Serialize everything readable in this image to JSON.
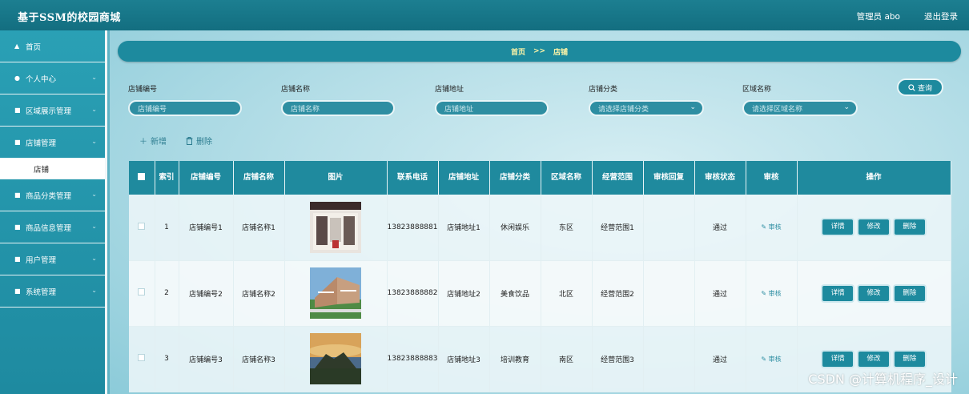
{
  "header": {
    "title": "基于SSM的校园商城",
    "role": "管理员 abo",
    "logout": "退出登录"
  },
  "sidebar": {
    "items": [
      {
        "label": "首页",
        "icon": "home-icon",
        "glyph": "▲",
        "chevron": false
      },
      {
        "label": "个人中心",
        "icon": "user-icon",
        "glyph": "●",
        "chevron": true
      },
      {
        "label": "区域展示管理",
        "icon": "comment-icon",
        "glyph": "■",
        "chevron": true
      },
      {
        "label": "店铺管理",
        "icon": "store-icon",
        "glyph": "■",
        "chevron": true
      },
      {
        "label": "商品分类管理",
        "icon": "grid-icon",
        "glyph": "■",
        "chevron": true
      },
      {
        "label": "商品信息管理",
        "icon": "grid-icon",
        "glyph": "■",
        "chevron": true
      },
      {
        "label": "用户管理",
        "icon": "users-icon",
        "glyph": "■",
        "chevron": true
      },
      {
        "label": "系统管理",
        "icon": "grid-icon",
        "glyph": "■",
        "chevron": true
      }
    ],
    "submenu_label": "店铺",
    "chevron_glyph": "⌄"
  },
  "breadcrumb": {
    "home": "首页",
    "separator": ">>",
    "current": "店铺"
  },
  "filters": [
    {
      "label": "店铺编号",
      "placeholder": "店铺编号"
    },
    {
      "label": "店铺名称",
      "placeholder": "店铺名称"
    },
    {
      "label": "店铺地址",
      "placeholder": "店铺地址"
    },
    {
      "label": "店铺分类",
      "placeholder": "请选择店铺分类"
    },
    {
      "label": "区域名称",
      "placeholder": "请选择区域名称"
    }
  ],
  "search_button": "查询",
  "actions": {
    "add": "新增",
    "delete": "删除"
  },
  "table": {
    "headers": [
      "索引",
      "店铺编号",
      "店铺名称",
      "图片",
      "联系电话",
      "店铺地址",
      "店铺分类",
      "区域名称",
      "经营范围",
      "审核回复",
      "审核状态",
      "审核",
      "操作"
    ],
    "rows": [
      {
        "index": "1",
        "code": "店铺编号1",
        "name": "店铺名称1",
        "phone": "13823888881",
        "address": "店铺地址1",
        "category": "休闲娱乐",
        "area": "东区",
        "scope": "经营范围1",
        "reply": "",
        "status": "通过",
        "audit": "审核"
      },
      {
        "index": "2",
        "code": "店铺编号2",
        "name": "店铺名称2",
        "phone": "13823888882",
        "address": "店铺地址2",
        "category": "美食饮品",
        "area": "北区",
        "scope": "经营范围2",
        "reply": "",
        "status": "通过",
        "audit": "审核"
      },
      {
        "index": "3",
        "code": "店铺编号3",
        "name": "店铺名称3",
        "phone": "13823888883",
        "address": "店铺地址3",
        "category": "培训教育",
        "area": "南区",
        "scope": "经营范围3",
        "reply": "",
        "status": "通过",
        "audit": "审核"
      }
    ],
    "ops": {
      "detail": "详情",
      "edit": "修改",
      "delete": "删除"
    }
  },
  "watermark": "CSDN @计算机程序_设计",
  "colors": {
    "primary": "#1d8a9e",
    "header": "#136e80",
    "accent_text": "#fff6a8"
  }
}
